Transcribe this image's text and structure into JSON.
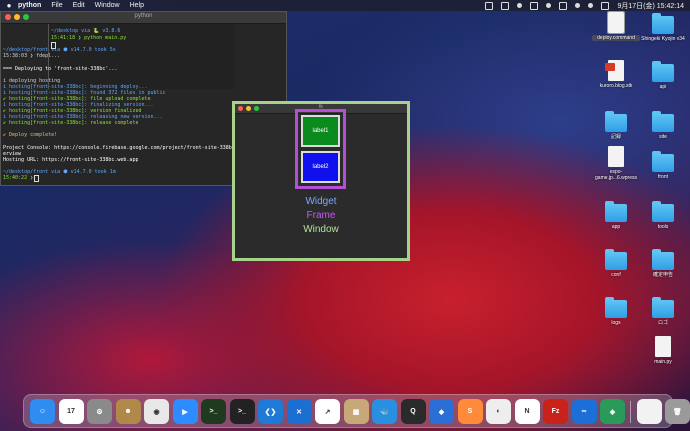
{
  "menubar": {
    "apple": "",
    "app": "python",
    "items": [
      "File",
      "Edit",
      "Window",
      "Help"
    ],
    "clock": "9月17日(金) 15:42:14"
  },
  "terminal": {
    "title": "python",
    "lines": [
      {
        "text": "~/desktop via 🐍 v3.8.6",
        "cls": "c-blue"
      },
      {
        "text": "15:41:18 ❯ python main.py",
        "cls": "c-green"
      },
      {
        "text": "~/desktop/front via ⬢ v14.7.0 took 5s",
        "cls": "c-blue"
      },
      {
        "text": "15:38:03 ❯ fdepl...",
        "cls": ""
      },
      {
        "text": "=== Deploying to 'front-site-338bc'...",
        "cls": "c-white"
      },
      {
        "text": "i  deploying hosting",
        "cls": ""
      },
      {
        "text": "i  hosting[front-site-338bc]: beginning deploy...",
        "cls": "c-blue"
      },
      {
        "text": "i  hosting[front-site-338bc]: found 372 files in public",
        "cls": "c-blue"
      },
      {
        "text": "✔  hosting[front-site-338bc]: file upload complete",
        "cls": "c-green"
      },
      {
        "text": "i  hosting[front-site-338bc]: finalizing version...",
        "cls": "c-blue"
      },
      {
        "text": "✔  hosting[front-site-338bc]: version finalized",
        "cls": "c-green"
      },
      {
        "text": "i  hosting[front-site-338bc]: releasing new version...",
        "cls": "c-blue"
      },
      {
        "text": "✔  hosting[front-site-338bc]: release complete",
        "cls": "c-green"
      },
      {
        "text": "✔  Deploy complete!",
        "cls": "c-yellow"
      },
      {
        "text": "Project Console: https://console.firebase.google.com/project/front-site-338bc/o",
        "cls": "c-white"
      },
      {
        "text": "erview",
        "cls": "c-white"
      },
      {
        "text": "Hosting URL: https://front-site-338bc.web.app",
        "cls": "c-white"
      },
      {
        "text": "~/desktop/front via ⬢ v14.7.0 took 1m",
        "cls": "c-blue"
      },
      {
        "text": "15:40:22 ❯",
        "cls": "c-green"
      }
    ]
  },
  "tk": {
    "title": "tk",
    "label1": "label1",
    "label2": "label2",
    "legend_widget": "Widget",
    "legend_frame": "Frame",
    "legend_window": "Window"
  },
  "desktop": [
    {
      "name": "deploy.command",
      "type": "doc",
      "selected": true
    },
    {
      "name": "Shingeki Kyojin v34",
      "type": "folder"
    },
    {
      "name": "kuroro.blog.stk",
      "type": "doc-badge"
    },
    {
      "name": "api",
      "type": "folder"
    },
    {
      "name": "記録",
      "type": "folder"
    },
    {
      "name": "site",
      "type": "folder"
    },
    {
      "name": "espo-game.jp...6.wpress",
      "type": "doc"
    },
    {
      "name": "front",
      "type": "folder"
    },
    {
      "name": "app",
      "type": "folder"
    },
    {
      "name": "tools",
      "type": "folder"
    },
    {
      "name": "conf",
      "type": "folder"
    },
    {
      "name": "確定申告",
      "type": "folder"
    },
    {
      "name": "logs",
      "type": "folder"
    },
    {
      "name": "ロゴ",
      "type": "folder"
    },
    {
      "name": "main.py",
      "type": "doc"
    }
  ],
  "dock": [
    {
      "name": "finder-icon",
      "color": "#2f8cf0",
      "glyph": "☺"
    },
    {
      "name": "calendar-icon",
      "color": "#ffffff",
      "glyph": "17"
    },
    {
      "name": "system-preferences-icon",
      "color": "#8a8a8a",
      "glyph": "⚙"
    },
    {
      "name": "contacts-icon",
      "color": "#b0884a",
      "glyph": "☻"
    },
    {
      "name": "chrome-icon",
      "color": "#e8e8e8",
      "glyph": "◉"
    },
    {
      "name": "zoom-icon",
      "color": "#2d8cff",
      "glyph": "▶"
    },
    {
      "name": "terminal-icon",
      "color": "#1f3a1f",
      "glyph": ">_"
    },
    {
      "name": "terminal2-icon",
      "color": "#222222",
      "glyph": ">_"
    },
    {
      "name": "vscode-icon",
      "color": "#1f7ad6",
      "glyph": "❮❯"
    },
    {
      "name": "xcode-icon",
      "color": "#1a6fd0",
      "glyph": "✕"
    },
    {
      "name": "activity-icon",
      "color": "#ffffff",
      "glyph": "↗"
    },
    {
      "name": "archive-icon",
      "color": "#c8a878",
      "glyph": "▦"
    },
    {
      "name": "docker-icon",
      "color": "#2a8fe0",
      "glyph": "🐳"
    },
    {
      "name": "quicktime-icon",
      "color": "#2a2a2a",
      "glyph": "Q"
    },
    {
      "name": "sourcetree-icon",
      "color": "#2a6fd6",
      "glyph": "◆"
    },
    {
      "name": "sublime-icon",
      "color": "#ff8a3a",
      "glyph": "S"
    },
    {
      "name": "preview-icon",
      "color": "#eeeeee",
      "glyph": "◐"
    },
    {
      "name": "notion-icon",
      "color": "#ffffff",
      "glyph": "N"
    },
    {
      "name": "filezilla-icon",
      "color": "#c8221a",
      "glyph": "Fz"
    },
    {
      "name": "infinity-icon",
      "color": "#1c6fd6",
      "glyph": "∞"
    },
    {
      "name": "cube-icon",
      "color": "#2a9a5a",
      "glyph": "◈"
    },
    {
      "name": "documents-icon",
      "color": "#f2f2f2",
      "glyph": ""
    },
    {
      "name": "trash-icon",
      "color": "#9a9a9a",
      "glyph": "🗑"
    }
  ],
  "colors": {
    "accent_green": "#a6d28a",
    "accent_purple": "#b24fd6",
    "label1_bg": "#0b8a1e",
    "label2_bg": "#1010ee"
  }
}
